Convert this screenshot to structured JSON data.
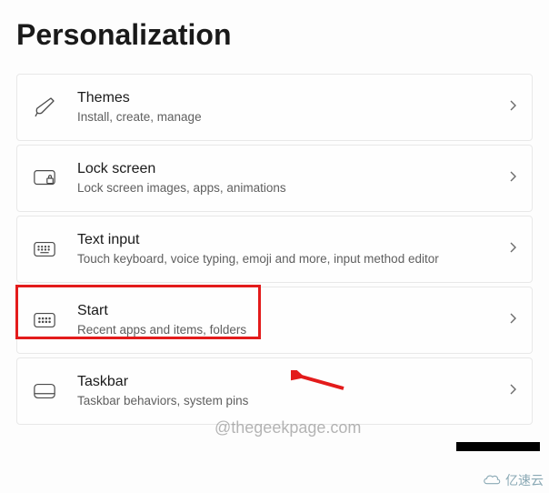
{
  "page": {
    "title": "Personalization"
  },
  "items": [
    {
      "title": "Themes",
      "desc": "Install, create, manage"
    },
    {
      "title": "Lock screen",
      "desc": "Lock screen images, apps, animations"
    },
    {
      "title": "Text input",
      "desc": "Touch keyboard, voice typing, emoji and more, input method editor"
    },
    {
      "title": "Start",
      "desc": "Recent apps and items, folders"
    },
    {
      "title": "Taskbar",
      "desc": "Taskbar behaviors, system pins"
    }
  ],
  "watermark": "@thegeekpage.com",
  "brand": "亿速云"
}
